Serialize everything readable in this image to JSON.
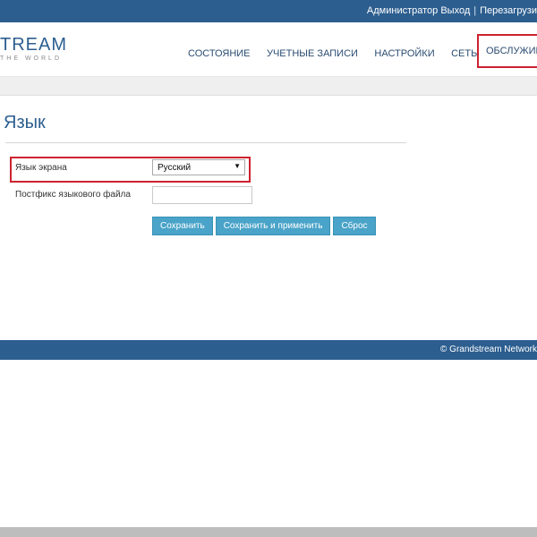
{
  "topbar": {
    "admin_logout": "Администратор Выход",
    "separator": "|",
    "reboot": "Перезагрузи"
  },
  "logo": {
    "brand": "TREAM",
    "tagline": "THE WORLD"
  },
  "nav": {
    "items": [
      {
        "label": "СОСТОЯНИЕ"
      },
      {
        "label": "УЧЕТНЫЕ ЗАПИСИ"
      },
      {
        "label": "НАСТРОЙКИ"
      },
      {
        "label": "СЕТЬ"
      },
      {
        "label": "ОБСЛУЖИВА"
      }
    ]
  },
  "page": {
    "title": "Язык"
  },
  "form": {
    "display_language_label": "Язык экрана",
    "display_language_value": "Русский",
    "language_file_postfix_label": "Постфикс языкового файла",
    "language_file_postfix_value": ""
  },
  "buttons": {
    "save": "Сохранить",
    "save_apply": "Сохранить и применить",
    "reset": "Сброс"
  },
  "footer": {
    "copyright": "© Grandstream Network"
  },
  "colors": {
    "primary": "#2c5e8f",
    "button": "#4aa3c8",
    "highlight": "#cc2230"
  }
}
